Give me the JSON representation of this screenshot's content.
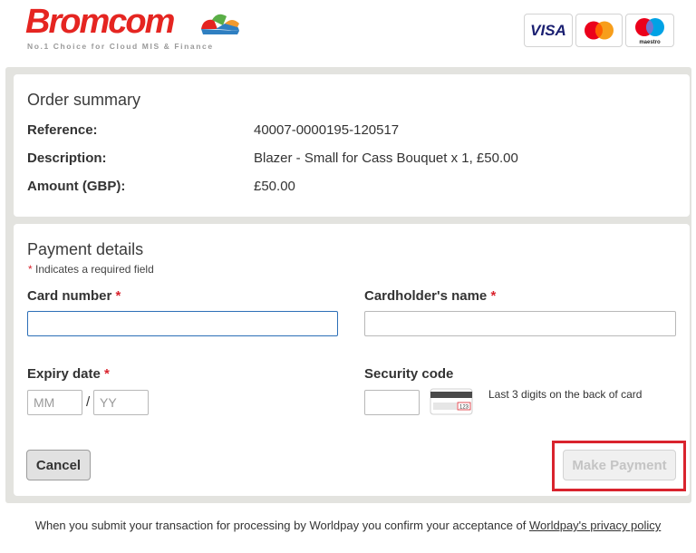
{
  "brand": {
    "name": "Bromcom",
    "tagline": "No.1 Choice for Cloud MIS & Finance",
    "colors": {
      "red": "#e52521",
      "blue": "#2f7fc1",
      "orange": "#f29a2e",
      "green": "#5aae47"
    }
  },
  "order_summary": {
    "title": "Order summary",
    "rows": [
      {
        "label": "Reference:",
        "value": "40007-0000195-120517"
      },
      {
        "label": "Description:",
        "value": "Blazer - Small for Cass Bouquet x 1, £50.00"
      },
      {
        "label": "Amount (GBP):",
        "value": "£50.00"
      }
    ]
  },
  "payment": {
    "title": "Payment details",
    "required_star": "*",
    "required_note": "Indicates a required field",
    "card_logos": [
      "visa",
      "mastercard",
      "maestro"
    ],
    "visa_text": "VISA",
    "maestro_text": "maestro",
    "card_number": {
      "label": "Card number",
      "value": ""
    },
    "cardholder_name": {
      "label": "Cardholder's name",
      "value": ""
    },
    "expiry": {
      "label": "Expiry date",
      "month_placeholder": "MM",
      "year_placeholder": "YY",
      "separator": "/"
    },
    "security_code": {
      "label": "Security code",
      "value": "",
      "hint": "Last 3 digits on the back of card",
      "card_digits": "123"
    },
    "cancel_label": "Cancel",
    "pay_label": "Make Payment"
  },
  "footer": {
    "text": "When you submit your transaction for processing by Worldpay you confirm your acceptance of",
    "link_text": "Worldpay's privacy policy"
  }
}
